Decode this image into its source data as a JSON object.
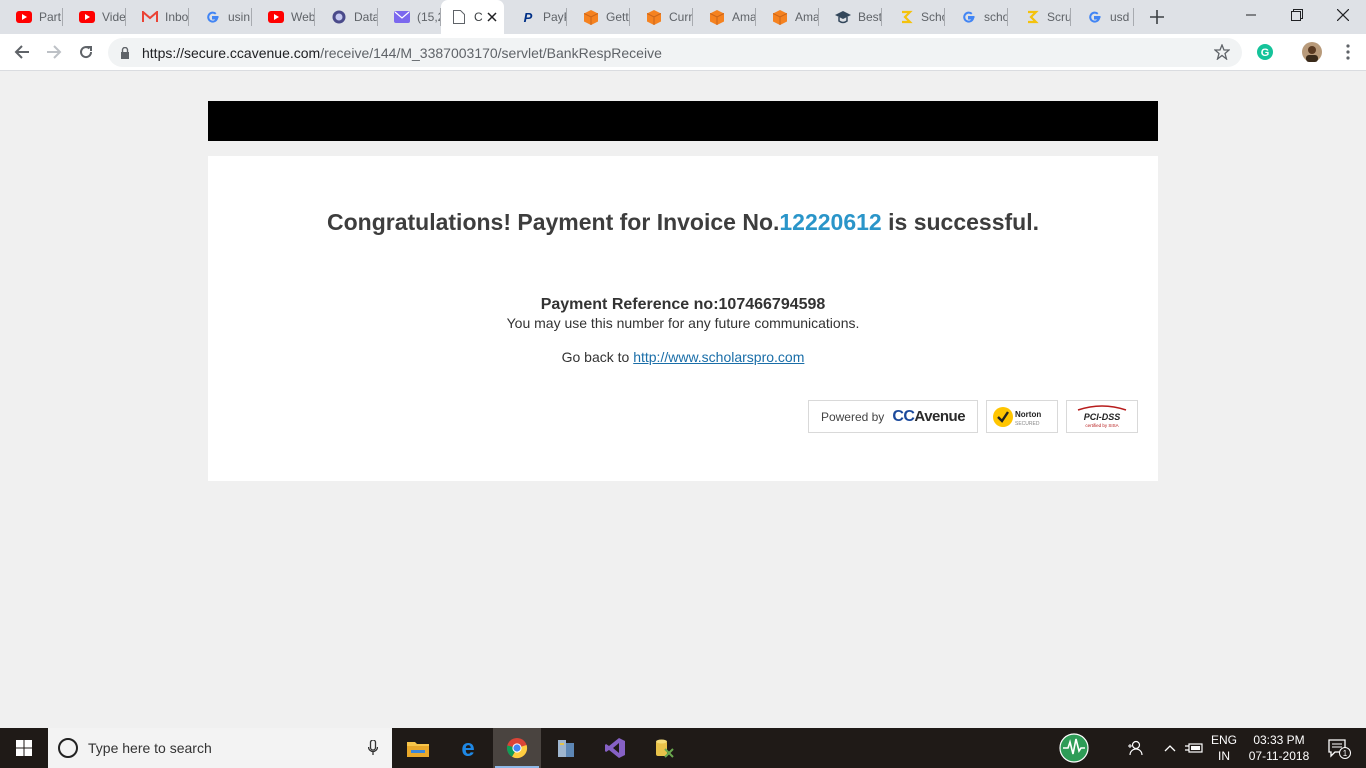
{
  "browser": {
    "tabs": [
      {
        "title": "Part",
        "icon": "youtube-icon",
        "color": "#ff0000"
      },
      {
        "title": "Vide",
        "icon": "youtube-icon",
        "color": "#ff0000"
      },
      {
        "title": "Inbo",
        "icon": "gmail-icon",
        "color": "#ea4335"
      },
      {
        "title": "usin",
        "icon": "google-icon",
        "color": "#4285f4"
      },
      {
        "title": "Web",
        "icon": "youtube-icon",
        "color": "#ff0000"
      },
      {
        "title": "Data",
        "icon": "globe-icon",
        "color": "#4a4a8a"
      },
      {
        "title": "(15,2",
        "icon": "mail-icon",
        "color": "#7b68ee"
      },
      {
        "title": "C",
        "icon": "page-icon",
        "color": "#5f6368",
        "active": true
      },
      {
        "title": "PayP",
        "icon": "paypal-icon",
        "color": "#003087"
      },
      {
        "title": "Gett",
        "icon": "box-icon",
        "color": "#f58220"
      },
      {
        "title": "Curr",
        "icon": "box-icon",
        "color": "#f58220"
      },
      {
        "title": "Ama",
        "icon": "box-icon",
        "color": "#f58220"
      },
      {
        "title": "Ama",
        "icon": "box-icon",
        "color": "#f58220"
      },
      {
        "title": "Best",
        "icon": "grad-cap-icon",
        "color": "#33475b"
      },
      {
        "title": "Scho",
        "icon": "scholars-icon",
        "color": "#f4c20d"
      },
      {
        "title": "scho",
        "icon": "google-icon",
        "color": "#4285f4"
      },
      {
        "title": "Scru",
        "icon": "scholars-icon",
        "color": "#f4c20d"
      },
      {
        "title": "usd",
        "icon": "google-icon",
        "color": "#4285f4"
      }
    ],
    "url_host": "https://secure.ccavenue.com",
    "url_path": "/receive/144/M_3387003170/servlet/BankRespReceive"
  },
  "page": {
    "headline_prefix": "Congratulations! Payment for Invoice No.",
    "invoice_no": "12220612",
    "headline_suffix": " is successful.",
    "reference": "Payment Reference no:107466794598",
    "reference_note": "You may use this number for any future communications.",
    "goback_label": "Go back to ",
    "goback_link": "http://www.scholarspro.com",
    "powered_by": "Powered by",
    "brand_cc": "CC",
    "brand_avenue": "Avenue",
    "norton_label": "Norton",
    "norton_sub": "SECURED",
    "pci_label": "PCI-DSS",
    "pci_sub": "certified by SISA"
  },
  "taskbar": {
    "search_placeholder": "Type here to search",
    "lang_top": "ENG",
    "lang_bottom": "IN",
    "time": "03:33 PM",
    "date": "07-11-2018",
    "notification_count": "1"
  },
  "colors": {
    "invoice_accent": "#2a95c9",
    "link": "#1a6ea8",
    "banner": "#000000"
  }
}
